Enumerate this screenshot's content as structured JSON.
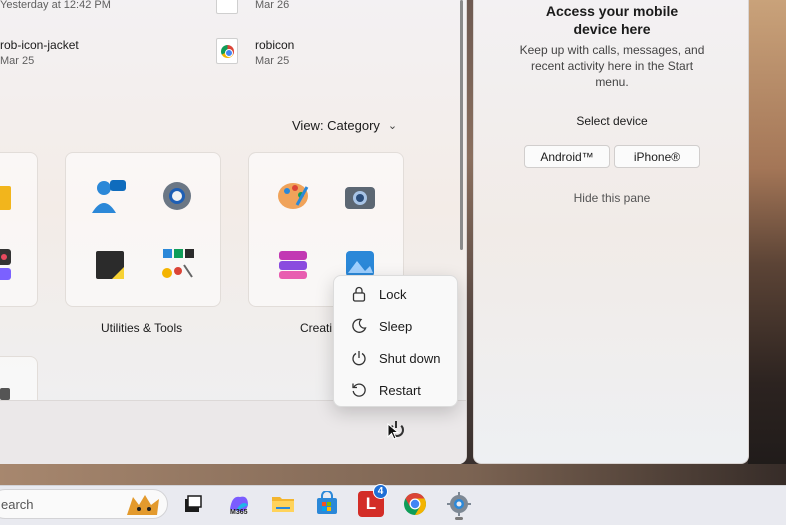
{
  "recent": [
    {
      "title": "",
      "date": "Yesterday at 12:42 PM"
    },
    {
      "title": "",
      "date": "Mar 26"
    },
    {
      "title": "rob-icon-jacket",
      "date": "Mar 25"
    },
    {
      "title": "robicon",
      "date": "Mar 25"
    }
  ],
  "view_selector": {
    "label": "View: Category"
  },
  "categories": [
    {
      "label": "Utilities & Tools"
    },
    {
      "label": "Creati"
    }
  ],
  "phone_pane": {
    "title_line1": "Access your mobile",
    "title_line2": "device here",
    "description": "Keep up with calls, messages, and recent activity here in the Start menu.",
    "select_device": "Select device",
    "android_label": "Android™",
    "iphone_label": "iPhone®",
    "hide_label": "Hide this pane"
  },
  "power_menu": {
    "items": [
      {
        "label": "Lock",
        "icon": "lock-icon"
      },
      {
        "label": "Sleep",
        "icon": "moon-icon"
      },
      {
        "label": "Shut down",
        "icon": "power-icon"
      },
      {
        "label": "Restart",
        "icon": "restart-icon"
      }
    ]
  },
  "taskbar": {
    "search_label": "earch",
    "icons": [
      "task-view-icon",
      "m365-icon",
      "file-explorer-icon",
      "microsoft-store-icon",
      "lastpass-icon",
      "chrome-icon",
      "settings-icon"
    ],
    "m365_label": "M365",
    "lastpass_label": "L",
    "badge_count": "4"
  },
  "colors": {
    "accent": "#1f6fd6",
    "chrome_red": "#db4437",
    "chrome_yellow": "#f4b400",
    "chrome_green": "#0f9d58",
    "chrome_blue": "#4285f4"
  }
}
